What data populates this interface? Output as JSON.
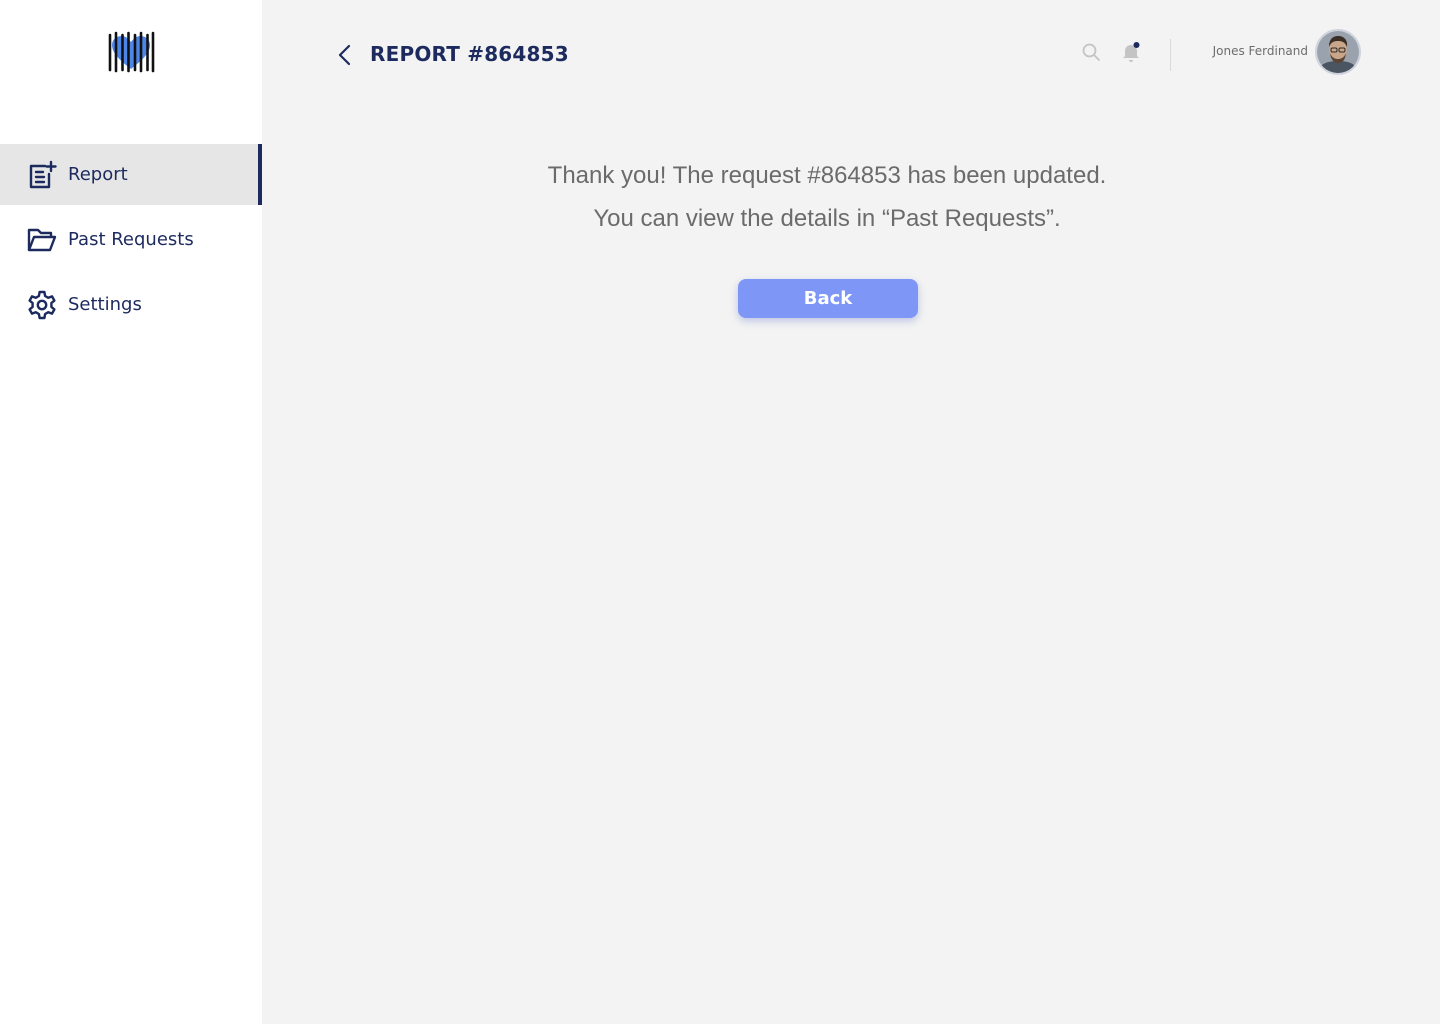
{
  "sidebar": {
    "logo": "barcode-heart-logo",
    "items": [
      {
        "label": "Report",
        "icon": "report-add-icon",
        "active": true
      },
      {
        "label": "Past Requests",
        "icon": "folder-open-icon",
        "active": false
      },
      {
        "label": "Settings",
        "icon": "gear-icon",
        "active": false
      }
    ]
  },
  "header": {
    "title": "REPORT #864853",
    "back_icon": "chevron-left-icon",
    "search_icon": "search-icon",
    "bell_icon": "bell-icon",
    "user_name": "Jones Ferdinand"
  },
  "main": {
    "message_line1": "Thank you! The request #864853 has been updated.",
    "message_line2": "You can view the details in “Past Requests”.",
    "back_button": "Back"
  },
  "colors": {
    "navy": "#1c2a5e",
    "accent": "#7e97f7",
    "background": "#f3f3f3",
    "sidebar_active": "#e6e6e6"
  }
}
